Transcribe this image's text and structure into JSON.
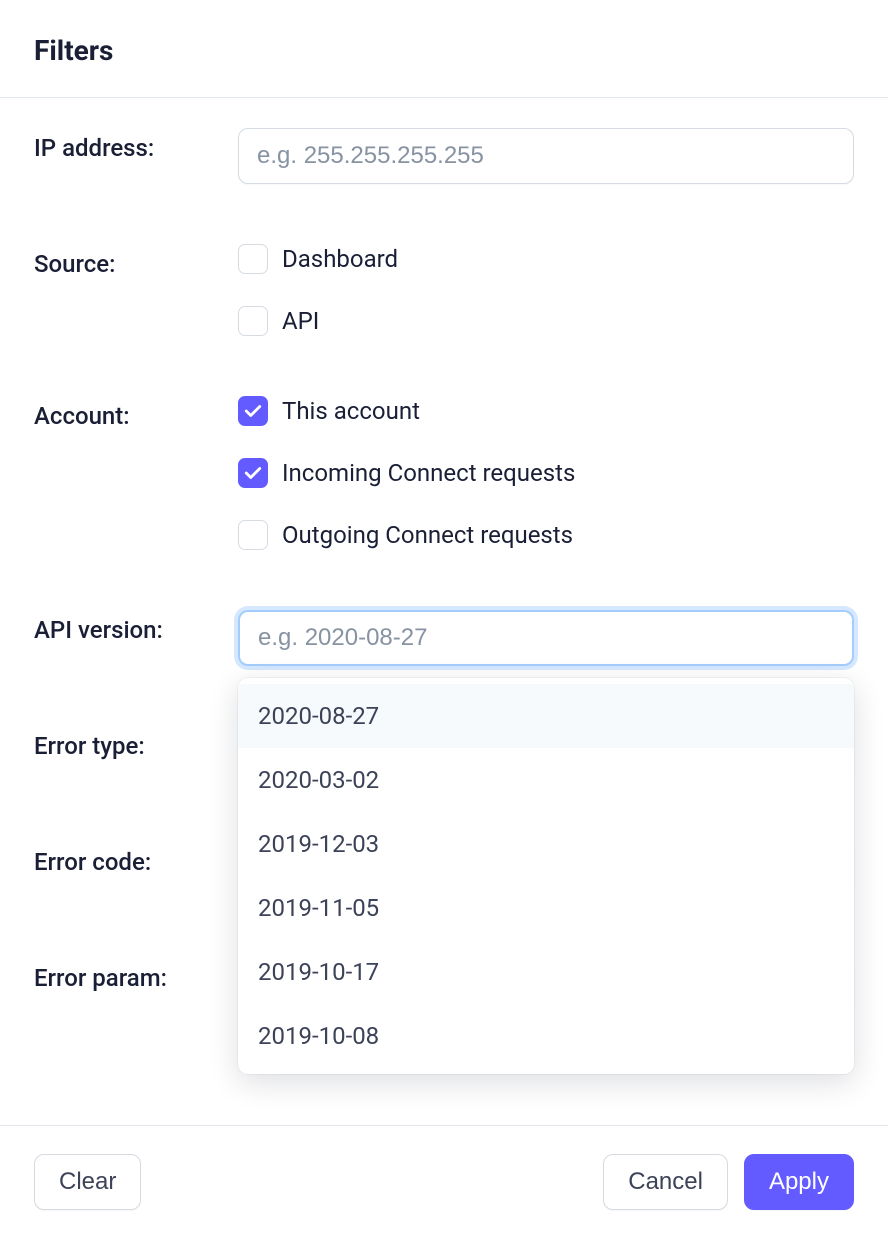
{
  "header": {
    "title": "Filters"
  },
  "fields": {
    "ip_address": {
      "label": "IP address:",
      "placeholder": "e.g. 255.255.255.255",
      "value": ""
    },
    "source": {
      "label": "Source:",
      "options": [
        {
          "label": "Dashboard",
          "checked": false
        },
        {
          "label": "API",
          "checked": false
        }
      ]
    },
    "account": {
      "label": "Account:",
      "options": [
        {
          "label": "This account",
          "checked": true
        },
        {
          "label": "Incoming Connect requests",
          "checked": true
        },
        {
          "label": "Outgoing Connect requests",
          "checked": false
        }
      ]
    },
    "api_version": {
      "label": "API version:",
      "placeholder": "e.g. 2020-08-27",
      "value": "",
      "dropdown_open": true,
      "highlighted_index": 0,
      "options": [
        "2020-08-27",
        "2020-03-02",
        "2019-12-03",
        "2019-11-05",
        "2019-10-17",
        "2019-10-08"
      ]
    },
    "error_type": {
      "label": "Error type:"
    },
    "error_code": {
      "label": "Error code:"
    },
    "error_param": {
      "label": "Error param:"
    }
  },
  "footer": {
    "clear_label": "Clear",
    "cancel_label": "Cancel",
    "apply_label": "Apply"
  },
  "colors": {
    "accent": "#635bff",
    "focus_ring": "#a4cdfe"
  }
}
